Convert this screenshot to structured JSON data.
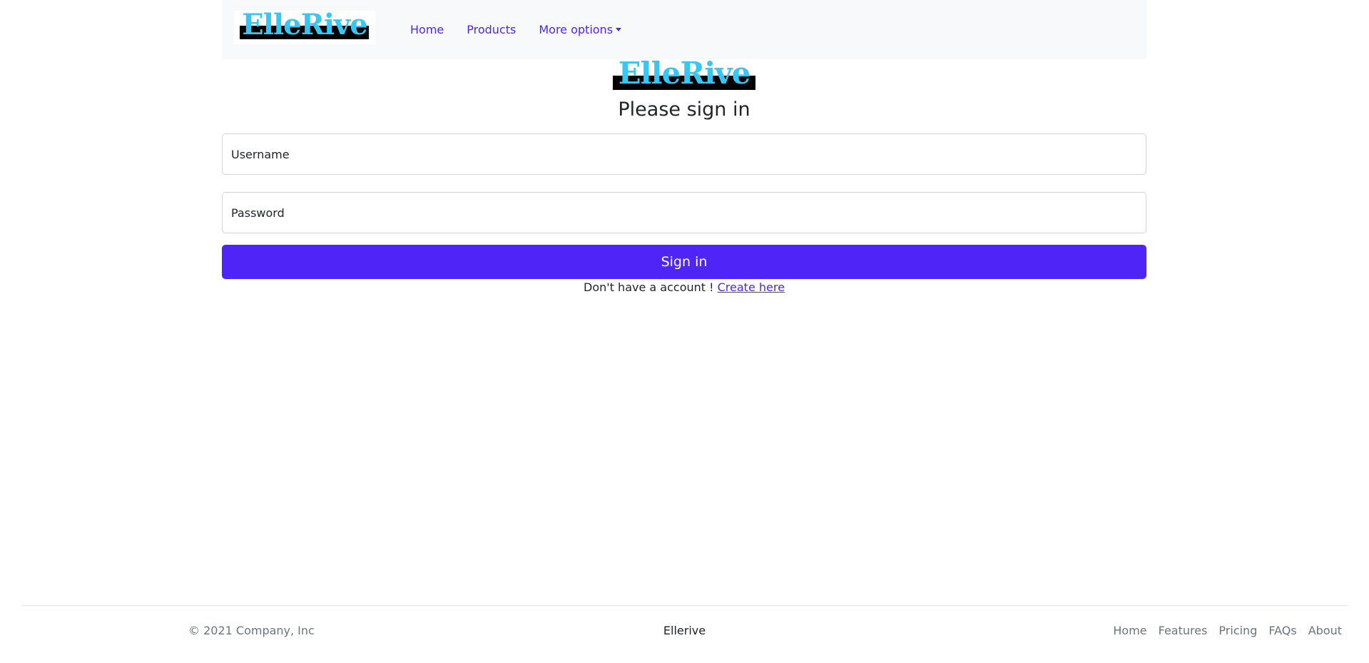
{
  "navbar": {
    "brand": "ElleRive",
    "links": [
      {
        "label": "Home"
      },
      {
        "label": "Products"
      },
      {
        "label": "More options"
      }
    ]
  },
  "signin": {
    "logo": "ElleRive",
    "heading": "Please sign in",
    "username_label": "Username",
    "password_label": "Password",
    "button_label": "Sign in",
    "no_account_text": "Don't have a account !",
    "create_link": "Create here"
  },
  "footer": {
    "copyright": "© 2021 Company, Inc",
    "brand": "Ellerive",
    "links": [
      {
        "label": "Home"
      },
      {
        "label": "Features"
      },
      {
        "label": "Pricing"
      },
      {
        "label": "FAQs"
      },
      {
        "label": "About"
      }
    ]
  },
  "colors": {
    "accent": "#4f25f7",
    "logo": "#38c6f4",
    "navbar_bg": "#f8f9fa"
  }
}
